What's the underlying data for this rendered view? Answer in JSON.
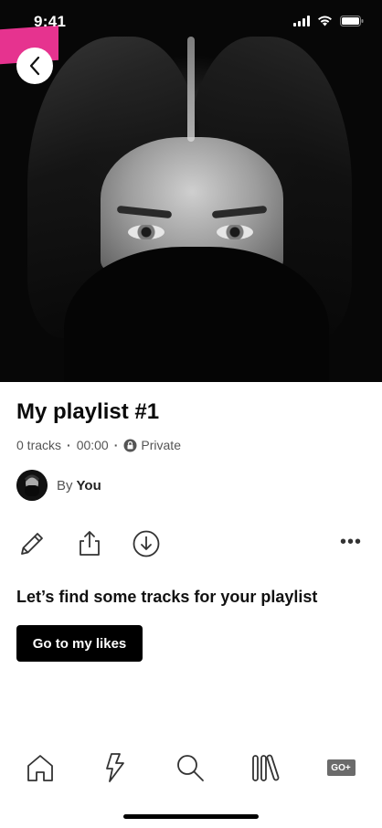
{
  "status_bar": {
    "time": "9:41"
  },
  "playlist": {
    "title": "My playlist #1",
    "tracks": "0 tracks",
    "duration": "00:00",
    "visibility": "Private",
    "owner_prefix": "By",
    "owner_name": "You"
  },
  "actions": {
    "edit_icon": "pencil-icon",
    "share_icon": "share-icon",
    "download_icon": "download-icon",
    "more_label": "•••"
  },
  "empty_state": {
    "message": "Let’s find some tracks for your playlist",
    "button_label": "Go to my likes"
  },
  "tabbar": {
    "items": [
      {
        "icon": "home-icon"
      },
      {
        "icon": "lightning-icon"
      },
      {
        "icon": "search-icon"
      },
      {
        "icon": "library-icon"
      },
      {
        "icon": "go-plus-badge",
        "label": "GO+"
      }
    ]
  },
  "colors": {
    "accent": "#e6338f",
    "button_bg": "#000000",
    "text": "#111111",
    "meta_text": "#555555"
  }
}
